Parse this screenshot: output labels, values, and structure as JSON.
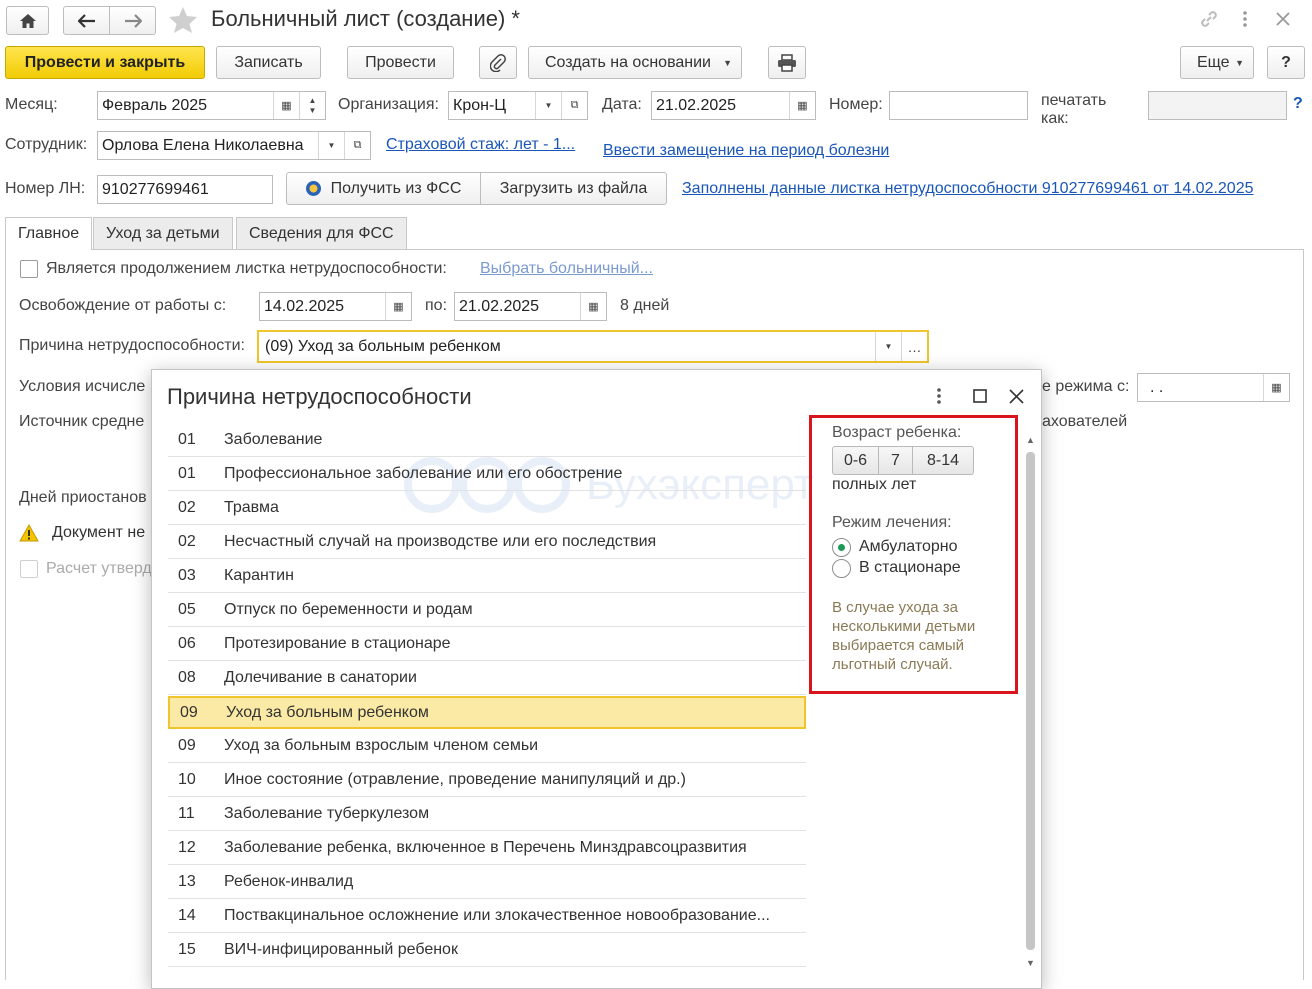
{
  "window": {
    "title": "Больничный лист (создание) *",
    "icons": [
      "home-icon",
      "back-arrow-icon",
      "forward-arrow-icon",
      "star-icon",
      "link-icon",
      "more-vert-icon",
      "close-icon"
    ]
  },
  "toolbar": {
    "post_close": "Провести и закрыть",
    "save": "Записать",
    "post": "Провести",
    "create_based": "Создать на основании",
    "more": "Еще",
    "help": "?"
  },
  "header": {
    "month_label": "Месяц:",
    "month_value": "Февраль 2025",
    "org_label": "Организация:",
    "org_value": "Крон-Ц",
    "date_label": "Дата:",
    "date_value": "21.02.2025",
    "number_label": "Номер:",
    "number_value": "",
    "print_as_label": "печатать как:",
    "print_as_value": "",
    "help_q": "?",
    "employee_label": "Сотрудник:",
    "employee_value": "Орлова Елена Николаевна",
    "insurance_link": "Страховой стаж: лет - 1...",
    "replacement_link": "Ввести замещение на период болезни",
    "ln_label": "Номер ЛН:",
    "ln_value": "910277699461",
    "get_fss": "Получить из ФСС",
    "load_file": "Загрузить из файла",
    "filled_link": "Заполнены данные листка нетрудоспособности 910277699461 от 14.02.2025"
  },
  "tabs": [
    "Главное",
    "Уход за детьми",
    "Сведения для ФСС"
  ],
  "main": {
    "continuation_label": "Является продолжением листка нетрудоспособности:",
    "select_link": "Выбрать больничный...",
    "release_label": "Освобождение от работы с:",
    "release_from": "14.02.2025",
    "release_to_label": "по:",
    "release_to": "21.02.2025",
    "days": "8 дней",
    "reason_label": "Причина нетрудоспособности:",
    "reason_value": "(09) Уход за больным ребенком",
    "conditions_label": "Условия исчисле",
    "regime_label": "е режима с:",
    "regime_value": ". .",
    "source_label": "Источник средне",
    "insurers_label": "ахователей",
    "days_suspended_label": "Дней приостанов",
    "warning_text": "Документ не",
    "calc_label": "Расчет утверд"
  },
  "dialog": {
    "title": "Причина нетрудоспособности",
    "watermark": "Бухэксперт",
    "rows": [
      {
        "code": "01",
        "name": "Заболевание"
      },
      {
        "code": "01",
        "name": "Профессиональное заболевание или его обострение"
      },
      {
        "code": "02",
        "name": "Травма"
      },
      {
        "code": "02",
        "name": "Несчастный случай на производстве или его последствия"
      },
      {
        "code": "03",
        "name": "Карантин"
      },
      {
        "code": "05",
        "name": "Отпуск по беременности и родам"
      },
      {
        "code": "06",
        "name": "Протезирование в стационаре"
      },
      {
        "code": "08",
        "name": "Долечивание в санатории"
      },
      {
        "code": "09",
        "name": "Уход за больным ребенком"
      },
      {
        "code": "09",
        "name": "Уход за больным взрослым членом семьи"
      },
      {
        "code": "10",
        "name": "Иное состояние (отравление, проведение манипуляций и др.)"
      },
      {
        "code": "11",
        "name": "Заболевание туберкулезом"
      },
      {
        "code": "12",
        "name": "Заболевание ребенка, включенное в Перечень Минздравсоцразвития"
      },
      {
        "code": "13",
        "name": "Ребенок-инвалид"
      },
      {
        "code": "14",
        "name": "Поствакцинальное осложнение или злокачественное новообразование..."
      },
      {
        "code": "15",
        "name": "ВИЧ-инфицированный ребенок"
      }
    ],
    "selected_index": 8,
    "age_label": "Возраст ребенка:",
    "age_options": [
      "0-6",
      "7",
      "8-14"
    ],
    "age_suffix": "полных лет",
    "mode_label": "Режим лечения:",
    "mode_options": [
      "Амбулаторно",
      "В стационаре"
    ],
    "mode_selected": 0,
    "note": "В случае ухода за несколькими детьми выбирается самый льготный случай.",
    "highlight_color": "#d9141c",
    "accent_color": "#f0c42c"
  }
}
